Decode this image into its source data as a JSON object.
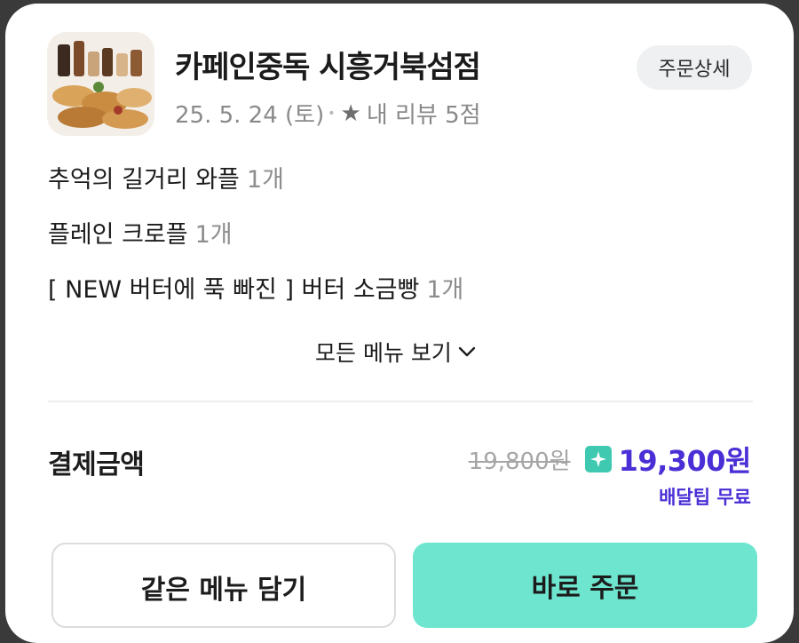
{
  "store": {
    "name": "카페인중독 시흥거북섬점",
    "date": "25. 5. 24 (토)",
    "separator": "•",
    "review_label": "내 리뷰 5점",
    "detail_button": "주문상세"
  },
  "items": [
    {
      "name": "추억의 길거리 와플",
      "qty": "1개"
    },
    {
      "name": "플레인 크로플",
      "qty": "1개"
    },
    {
      "name": "[ NEW 버터에 푹 빠진 ] 버터 소금빵",
      "qty": "1개"
    }
  ],
  "all_menu_label": "모든 메뉴 보기",
  "payment": {
    "label": "결제금액",
    "original_price": "19,800원",
    "final_price": "19,300원",
    "delivery_tip": "배달팁 무료"
  },
  "buttons": {
    "add_same": "같은 메뉴 담기",
    "order_now": "바로 주문"
  },
  "colors": {
    "accent_purple": "#4a2fd6",
    "primary_button": "#6ee6cf",
    "badge_teal": "#3ec9b0"
  },
  "icons": {
    "review_star": "star-icon",
    "expand": "chevron-down-icon",
    "discount_badge": "sparkle-icon"
  }
}
